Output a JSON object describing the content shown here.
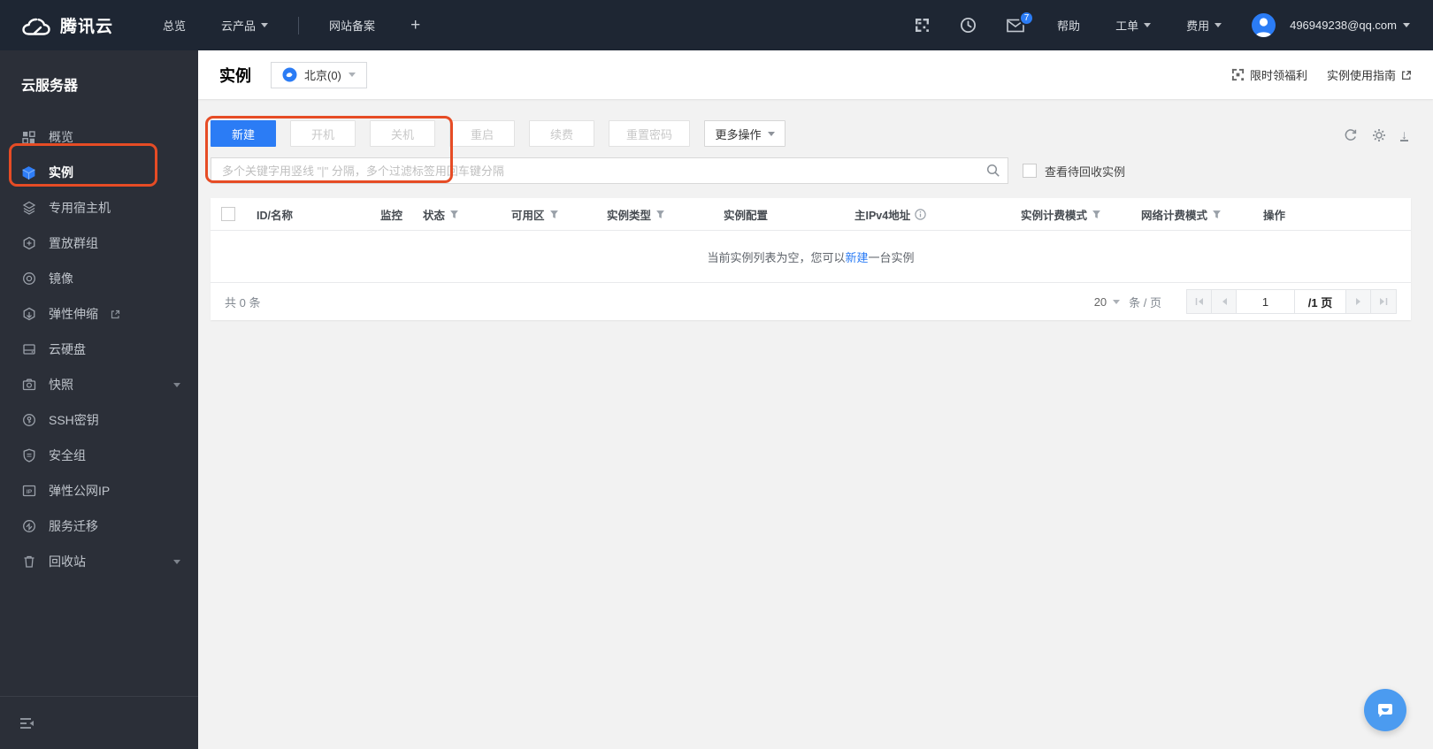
{
  "topnav": {
    "brand": "腾讯云",
    "overview": "总览",
    "products": "云产品",
    "beian": "网站备案",
    "plus": "+",
    "mail_badge": "7",
    "help": "帮助",
    "ticket": "工单",
    "billing": "费用",
    "account": "496949238@qq.com"
  },
  "sidebar": {
    "title": "云服务器",
    "items": [
      {
        "label": "概览"
      },
      {
        "label": "实例"
      },
      {
        "label": "专用宿主机"
      },
      {
        "label": "置放群组"
      },
      {
        "label": "镜像"
      },
      {
        "label": "弹性伸缩"
      },
      {
        "label": "云硬盘"
      },
      {
        "label": "快照"
      },
      {
        "label": "SSH密钥"
      },
      {
        "label": "安全组"
      },
      {
        "label": "弹性公网IP"
      },
      {
        "label": "服务迁移"
      },
      {
        "label": "回收站"
      }
    ]
  },
  "header": {
    "title": "实例",
    "region": "北京(0)",
    "promo": "限时领福利",
    "guide": "实例使用指南"
  },
  "toolbar": {
    "create": "新建",
    "power_on": "开机",
    "shutdown": "关机",
    "restart": "重启",
    "renew": "续费",
    "reset_password": "重置密码",
    "more": "更多操作"
  },
  "search": {
    "placeholder": "多个关键字用竖线 \"|\" 分隔，多个过滤标签用回车键分隔",
    "recycle_checkbox": "查看待回收实例"
  },
  "table": {
    "columns": {
      "id_name": "ID/名称",
      "monitor": "监控",
      "status": "状态",
      "zone": "可用区",
      "instance_type": "实例类型",
      "config": "实例配置",
      "ipv4": "主IPv4地址",
      "billing_mode": "实例计费模式",
      "network_billing": "网络计费模式",
      "operation": "操作"
    },
    "empty_prefix": "当前实例列表为空，您可以",
    "empty_link": "新建",
    "empty_suffix": "一台实例"
  },
  "pagination": {
    "total": "共 0 条",
    "page_size": "20",
    "unit": "条 / 页",
    "current_page": "1",
    "page_total": "/1 页"
  },
  "colors": {
    "accent": "#2B7CF5",
    "annotation": "#E64C25",
    "topnav_bg": "#1E2633",
    "sidebar_bg": "#2B2F38"
  }
}
